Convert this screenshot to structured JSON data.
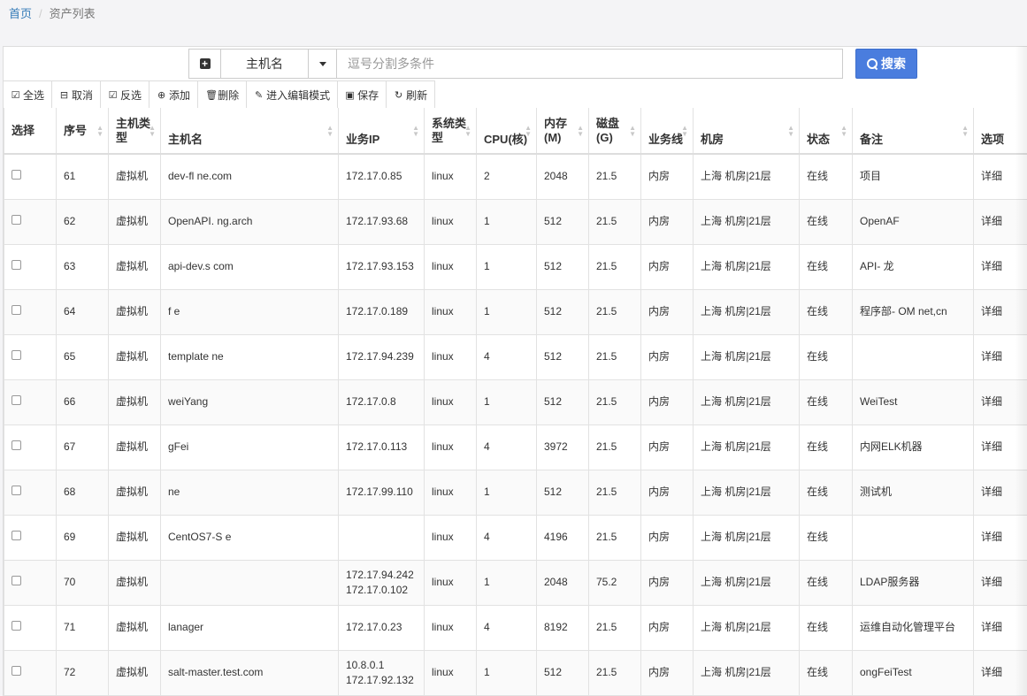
{
  "breadcrumb": {
    "home": "首页",
    "separator": "/",
    "current": "资产列表"
  },
  "search": {
    "field_selected": "主机名",
    "placeholder": "逗号分割多条件",
    "button_label": "搜索"
  },
  "toolbar": {
    "select_all": "全选",
    "cancel": "取消",
    "invert": "反选",
    "add": "添加",
    "delete": "删除",
    "edit_mode": "进入编辑模式",
    "save": "保存",
    "refresh": "刷新"
  },
  "table": {
    "headers": [
      "选择",
      "序号",
      "主机类型",
      "主机名",
      "业务IP",
      "系统类型",
      "CPU(核)",
      "内存(M)",
      "磁盘(G)",
      "业务线",
      "机房",
      "状态",
      "备注",
      "选项"
    ],
    "rows": [
      {
        "seq": "61",
        "type": "虚拟机",
        "host": "dev-fl ne.com",
        "ip": "172.17.0.85",
        "os": "linux",
        "cpu": "2",
        "mem": "2048",
        "disk": "21.5",
        "biz": "内房",
        "room": "上海 机房|21层",
        "status": "在线",
        "note": "项目",
        "option": "详细"
      },
      {
        "seq": "62",
        "type": "虚拟机",
        "host": "OpenAPI. ng.arch",
        "ip": "172.17.93.68",
        "os": "linux",
        "cpu": "1",
        "mem": "512",
        "disk": "21.5",
        "biz": "内房",
        "room": "上海 机房|21层",
        "status": "在线",
        "note": "OpenAF",
        "option": "详细"
      },
      {
        "seq": "63",
        "type": "虚拟机",
        "host": "api-dev.s com",
        "ip": "172.17.93.153",
        "os": "linux",
        "cpu": "1",
        "mem": "512",
        "disk": "21.5",
        "biz": "内房",
        "room": "上海 机房|21层",
        "status": "在线",
        "note": "API- 龙",
        "option": "详细"
      },
      {
        "seq": "64",
        "type": "虚拟机",
        "host": "f e",
        "ip": "172.17.0.189",
        "os": "linux",
        "cpu": "1",
        "mem": "512",
        "disk": "21.5",
        "biz": "内房",
        "room": "上海 机房|21层",
        "status": "在线",
        "note": "程序部- OM net,cn",
        "option": "详细"
      },
      {
        "seq": "65",
        "type": "虚拟机",
        "host": "template ne",
        "ip": "172.17.94.239",
        "os": "linux",
        "cpu": "4",
        "mem": "512",
        "disk": "21.5",
        "biz": "内房",
        "room": "上海 机房|21层",
        "status": "在线",
        "note": "",
        "option": "详细"
      },
      {
        "seq": "66",
        "type": "虚拟机",
        "host": "weiYang",
        "ip": "172.17.0.8",
        "os": "linux",
        "cpu": "1",
        "mem": "512",
        "disk": "21.5",
        "biz": "内房",
        "room": "上海 机房|21层",
        "status": "在线",
        "note": "WeiTest",
        "option": "详细"
      },
      {
        "seq": "67",
        "type": "虚拟机",
        "host": "gFei",
        "ip": "172.17.0.113",
        "os": "linux",
        "cpu": "4",
        "mem": "3972",
        "disk": "21.5",
        "biz": "内房",
        "room": "上海 机房|21层",
        "status": "在线",
        "note": "内网ELK机器",
        "option": "详细"
      },
      {
        "seq": "68",
        "type": "虚拟机",
        "host": "ne",
        "ip": "172.17.99.110",
        "os": "linux",
        "cpu": "1",
        "mem": "512",
        "disk": "21.5",
        "biz": "内房",
        "room": "上海 机房|21层",
        "status": "在线",
        "note": "测试机",
        "option": "详细"
      },
      {
        "seq": "69",
        "type": "虚拟机",
        "host": "CentOS7-S e",
        "ip": "",
        "os": "linux",
        "cpu": "4",
        "mem": "4196",
        "disk": "21.5",
        "biz": "内房",
        "room": "上海 机房|21层",
        "status": "在线",
        "note": "",
        "option": "详细"
      },
      {
        "seq": "70",
        "type": "虚拟机",
        "host": "",
        "ip": "172.17.94.242\n172.17.0.102",
        "os": "linux",
        "cpu": "1",
        "mem": "2048",
        "disk": "75.2",
        "biz": "内房",
        "room": "上海 机房|21层",
        "status": "在线",
        "note": "LDAP服务器",
        "option": "详细"
      },
      {
        "seq": "71",
        "type": "虚拟机",
        "host": "lanager",
        "ip": "172.17.0.23",
        "os": "linux",
        "cpu": "4",
        "mem": "8192",
        "disk": "21.5",
        "biz": "内房",
        "room": "上海 机房|21层",
        "status": "在线",
        "note": "运维自动化管理平台",
        "option": "详细"
      },
      {
        "seq": "72",
        "type": "虚拟机",
        "host": "salt-master.test.com",
        "ip": "10.8.0.1\n172.17.92.132",
        "os": "linux",
        "cpu": "1",
        "mem": "512",
        "disk": "21.5",
        "biz": "内房",
        "room": "上海 机房|21层",
        "status": "在线",
        "note": "ongFeiTest",
        "option": "详细"
      }
    ]
  }
}
